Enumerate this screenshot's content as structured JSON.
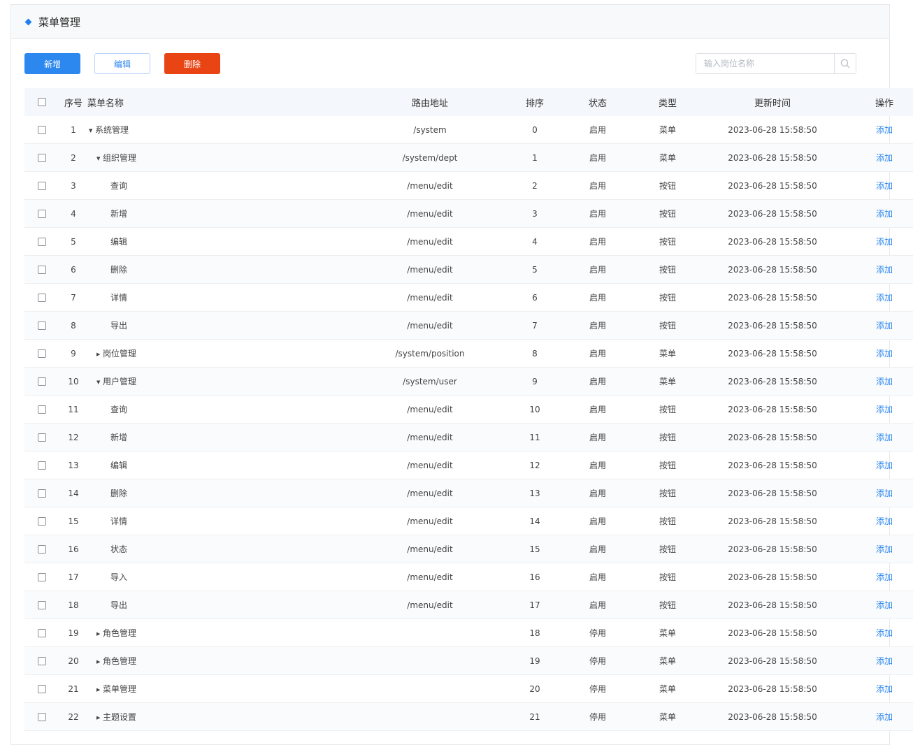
{
  "header": {
    "title": "菜单管理"
  },
  "toolbar": {
    "add_label": "新增",
    "edit_label": "编辑",
    "delete_label": "删除"
  },
  "search": {
    "placeholder": "输入岗位名称",
    "icon": "search-icon"
  },
  "colors": {
    "primary": "#2c87ef",
    "danger": "#e84414",
    "accent": "#1e7ff0"
  },
  "table": {
    "columns": [
      "序号",
      "菜单名称",
      "路由地址",
      "排序",
      "状态",
      "类型",
      "更新时间",
      "操作"
    ],
    "rows": [
      {
        "no": "1",
        "name": "系统管理",
        "level": 0,
        "toggle": "expanded",
        "path": "/system",
        "sort": "0",
        "status": "启用",
        "type": "菜单",
        "time": "2023-06-28 15:58:50",
        "action": "添加"
      },
      {
        "no": "2",
        "name": "组织管理",
        "level": 1,
        "toggle": "expanded",
        "path": "/system/dept",
        "sort": "1",
        "status": "启用",
        "type": "菜单",
        "time": "2023-06-28 15:58:50",
        "action": "添加"
      },
      {
        "no": "3",
        "name": "查询",
        "level": 2,
        "toggle": "none",
        "path": "/menu/edit",
        "sort": "2",
        "status": "启用",
        "type": "按钮",
        "time": "2023-06-28 15:58:50",
        "action": "添加"
      },
      {
        "no": "4",
        "name": "新增",
        "level": 2,
        "toggle": "none",
        "path": "/menu/edit",
        "sort": "3",
        "status": "启用",
        "type": "按钮",
        "time": "2023-06-28 15:58:50",
        "action": "添加"
      },
      {
        "no": "5",
        "name": "编辑",
        "level": 2,
        "toggle": "none",
        "path": "/menu/edit",
        "sort": "4",
        "status": "启用",
        "type": "按钮",
        "time": "2023-06-28 15:58:50",
        "action": "添加"
      },
      {
        "no": "6",
        "name": "删除",
        "level": 2,
        "toggle": "none",
        "path": "/menu/edit",
        "sort": "5",
        "status": "启用",
        "type": "按钮",
        "time": "2023-06-28 15:58:50",
        "action": "添加"
      },
      {
        "no": "7",
        "name": "详情",
        "level": 2,
        "toggle": "none",
        "path": "/menu/edit",
        "sort": "6",
        "status": "启用",
        "type": "按钮",
        "time": "2023-06-28 15:58:50",
        "action": "添加"
      },
      {
        "no": "8",
        "name": "导出",
        "level": 2,
        "toggle": "none",
        "path": "/menu/edit",
        "sort": "7",
        "status": "启用",
        "type": "按钮",
        "time": "2023-06-28 15:58:50",
        "action": "添加"
      },
      {
        "no": "9",
        "name": "岗位管理",
        "level": 1,
        "toggle": "collapsed",
        "path": "/system/position",
        "sort": "8",
        "status": "启用",
        "type": "菜单",
        "time": "2023-06-28 15:58:50",
        "action": "添加"
      },
      {
        "no": "10",
        "name": "用户管理",
        "level": 1,
        "toggle": "expanded",
        "path": "/system/user",
        "sort": "9",
        "status": "启用",
        "type": "菜单",
        "time": "2023-06-28 15:58:50",
        "action": "添加"
      },
      {
        "no": "11",
        "name": "查询",
        "level": 2,
        "toggle": "none",
        "path": "/menu/edit",
        "sort": "10",
        "status": "启用",
        "type": "按钮",
        "time": "2023-06-28 15:58:50",
        "action": "添加"
      },
      {
        "no": "12",
        "name": "新增",
        "level": 2,
        "toggle": "none",
        "path": "/menu/edit",
        "sort": "11",
        "status": "启用",
        "type": "按钮",
        "time": "2023-06-28 15:58:50",
        "action": "添加"
      },
      {
        "no": "13",
        "name": "编辑",
        "level": 2,
        "toggle": "none",
        "path": "/menu/edit",
        "sort": "12",
        "status": "启用",
        "type": "按钮",
        "time": "2023-06-28 15:58:50",
        "action": "添加"
      },
      {
        "no": "14",
        "name": "删除",
        "level": 2,
        "toggle": "none",
        "path": "/menu/edit",
        "sort": "13",
        "status": "启用",
        "type": "按钮",
        "time": "2023-06-28 15:58:50",
        "action": "添加"
      },
      {
        "no": "15",
        "name": "详情",
        "level": 2,
        "toggle": "none",
        "path": "/menu/edit",
        "sort": "14",
        "status": "启用",
        "type": "按钮",
        "time": "2023-06-28 15:58:50",
        "action": "添加"
      },
      {
        "no": "16",
        "name": "状态",
        "level": 2,
        "toggle": "none",
        "path": "/menu/edit",
        "sort": "15",
        "status": "启用",
        "type": "按钮",
        "time": "2023-06-28 15:58:50",
        "action": "添加"
      },
      {
        "no": "17",
        "name": "导入",
        "level": 2,
        "toggle": "none",
        "path": "/menu/edit",
        "sort": "16",
        "status": "启用",
        "type": "按钮",
        "time": "2023-06-28 15:58:50",
        "action": "添加"
      },
      {
        "no": "18",
        "name": "导出",
        "level": 2,
        "toggle": "none",
        "path": "/menu/edit",
        "sort": "17",
        "status": "启用",
        "type": "按钮",
        "time": "2023-06-28 15:58:50",
        "action": "添加"
      },
      {
        "no": "19",
        "name": "角色管理",
        "level": 1,
        "toggle": "collapsed",
        "path": "",
        "sort": "18",
        "status": "停用",
        "type": "菜单",
        "time": "2023-06-28 15:58:50",
        "action": "添加"
      },
      {
        "no": "20",
        "name": "角色管理",
        "level": 1,
        "toggle": "collapsed",
        "path": "",
        "sort": "19",
        "status": "停用",
        "type": "菜单",
        "time": "2023-06-28 15:58:50",
        "action": "添加"
      },
      {
        "no": "21",
        "name": "菜单管理",
        "level": 1,
        "toggle": "collapsed",
        "path": "",
        "sort": "20",
        "status": "停用",
        "type": "菜单",
        "time": "2023-06-28 15:58:50",
        "action": "添加"
      },
      {
        "no": "22",
        "name": "主题设置",
        "level": 1,
        "toggle": "collapsed",
        "path": "",
        "sort": "21",
        "status": "停用",
        "type": "菜单",
        "time": "2023-06-28 15:58:50",
        "action": "添加"
      }
    ]
  }
}
